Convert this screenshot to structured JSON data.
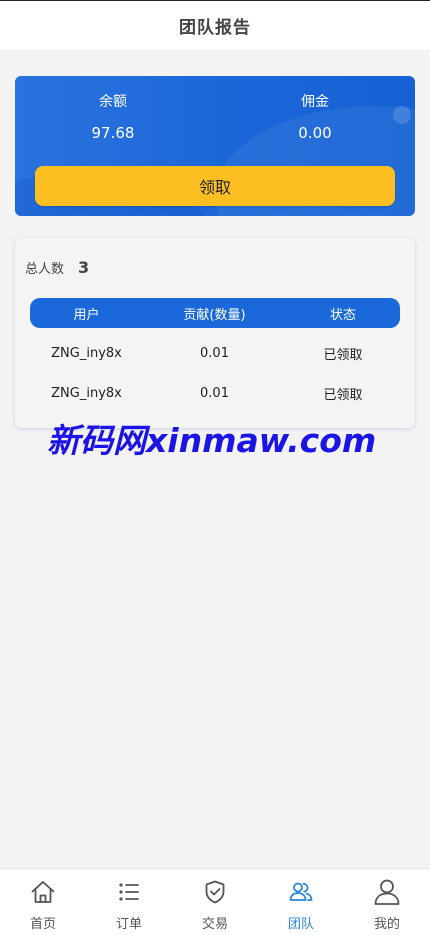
{
  "header": {
    "title": "团队报告"
  },
  "balance": {
    "balance_label": "余额",
    "balance_value": "97.68",
    "commission_label": "佣金",
    "commission_value": "0.00",
    "claim_label": "领取"
  },
  "team": {
    "total_label": "总人数",
    "total_value": "3",
    "columns": [
      "用户",
      "贡献(数量)",
      "状态"
    ],
    "rows": [
      {
        "user": "ZNG_iny8x",
        "contribution": "0.01",
        "status": "已领取"
      },
      {
        "user": "ZNG_iny8x",
        "contribution": "0.01",
        "status": "已领取"
      }
    ]
  },
  "watermark": "新码网xinmaw.com",
  "tabbar": {
    "items": [
      {
        "label": "首页",
        "icon": "home-icon"
      },
      {
        "label": "订单",
        "icon": "list-icon"
      },
      {
        "label": "交易",
        "icon": "shield-check-icon"
      },
      {
        "label": "团队",
        "icon": "team-icon"
      },
      {
        "label": "我的",
        "icon": "user-icon"
      }
    ],
    "active_index": 3
  },
  "colors": {
    "primary": "#1a68d9",
    "accent_button": "#fbbf22",
    "active_tab": "#2b88d8",
    "watermark": "#1c14e6"
  }
}
